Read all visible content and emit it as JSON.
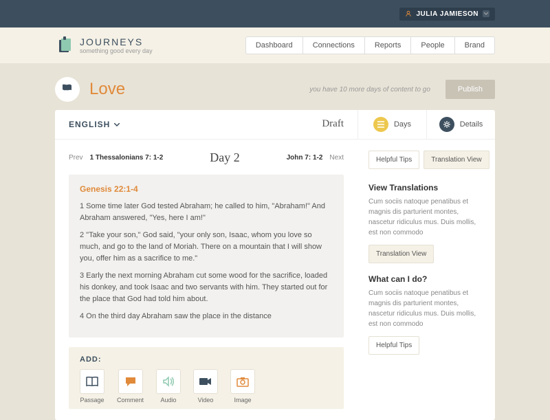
{
  "user": {
    "name": "JULIA JAMIESON"
  },
  "brand": {
    "title": "JOURNEYS",
    "tagline": "something good every day"
  },
  "nav": [
    "Dashboard",
    "Connections",
    "Reports",
    "People",
    "Brand"
  ],
  "page": {
    "title": "Love",
    "publish_hint": "you have 10 more days of content to go",
    "publish_btn": "Publish"
  },
  "card": {
    "language": "ENGLISH",
    "status": "Draft",
    "tabs": {
      "days": "Days",
      "details": "Details"
    }
  },
  "daynav": {
    "prev_label": "Prev",
    "prev_ref": "1 Thessalonians 7: 1-2",
    "title": "Day 2",
    "next_ref": "John 7: 1-2",
    "next_label": "Next"
  },
  "scripture": {
    "ref": "Genesis 22:1-4",
    "v1": "1 Some time later God tested Abraham; he called to him, \"Abraham!\" And Abraham answered, \"Yes, here I am!\"",
    "v2": "2 \"Take your son,\" God said, \"your only son, Isaac, whom you love so much, and go to the land of Moriah. There on a mountain that I will show you, offer him as a sacrifice to me.\"",
    "v3": "3 Early the next morning Abraham cut some wood for the sacrifice, loaded his donkey, and took Isaac and two servants with him. They started out for the place that God had told him about.",
    "v4": "4 On the third day Abraham saw the place in the distance"
  },
  "add": {
    "title": "ADD:",
    "items": {
      "passage": "Passage",
      "comment": "Comment",
      "audio": "Audio",
      "video": "Video",
      "image": "Image"
    }
  },
  "side": {
    "tips_btn": "Helpful Tips",
    "trans_btn": "Translation View",
    "sec1_title": "View Translations",
    "sec1_body": "Cum sociis natoque penatibus et magnis dis parturient montes, nascetur ridiculus mus. Duis mollis, est non commodo",
    "sec1_btn": "Translation View",
    "sec2_title": "What can I do?",
    "sec2_body": "Cum sociis natoque penatibus et magnis dis parturient montes, nascetur ridiculus mus. Duis mollis, est non commodo",
    "sec2_btn": "Helpful Tips"
  }
}
